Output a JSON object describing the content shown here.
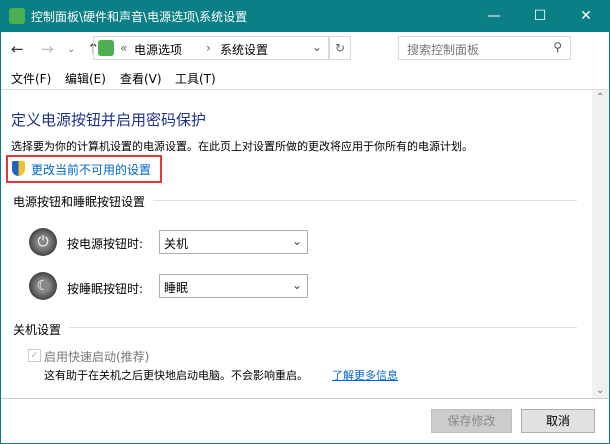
{
  "window": {
    "title": "控制面板\\硬件和声音\\电源选项\\系统设置",
    "minimize": "—",
    "maximize": "☐",
    "close": "✕"
  },
  "address": {
    "chevron": "«",
    "crumbs": [
      "电源选项",
      "系统设置"
    ],
    "sep": "›",
    "search_placeholder": "搜索控制面板"
  },
  "menu": [
    "文件(F)",
    "编辑(E)",
    "查看(V)",
    "工具(T)"
  ],
  "main": {
    "heading": "定义电源按钮并启用密码保护",
    "description": "选择要为你的计算机设置的电源设置。在此页上对设置所做的更改将应用于你所有的电源计划。",
    "change_link": "更改当前不可用的设置",
    "section1": "电源按钮和睡眠按钮设置",
    "power_label": "按电源按钮时:",
    "power_value": "关机",
    "sleep_label": "按睡眠按钮时:",
    "sleep_value": "睡眠",
    "section2": "关机设置",
    "fast_startup": "启用快速启动(推荐)",
    "fast_desc": "这有助于在关机之后更快地启动电脑。不会影响重启。",
    "learn_more": "了解更多信息"
  },
  "footer": {
    "save": "保存修改",
    "cancel": "取消"
  }
}
